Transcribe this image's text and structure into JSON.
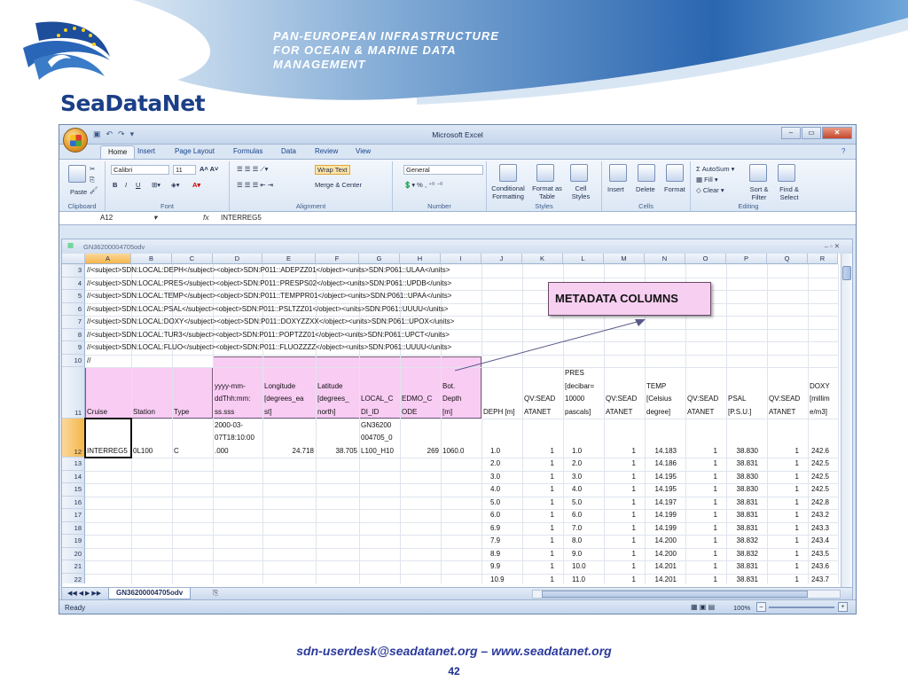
{
  "slide": {
    "header_lines": [
      "PAN-EUROPEAN INFRASTRUCTURE",
      "FOR OCEAN & MARINE DATA",
      "MANAGEMENT"
    ],
    "brand": "SeaDataNet",
    "footer": "sdn-userdesk@seadatanet.org – www.seadatanet.org",
    "page_number": "42",
    "callout": "METADATA COLUMNS",
    "colors": {
      "swoosh_blue": "#2f6fb7",
      "brand_blue": "#1b3f86",
      "callout_pink": "#f7cff1"
    }
  },
  "excel": {
    "window_title": "Microsoft Excel",
    "tabs": [
      "Home",
      "Insert",
      "Page Layout",
      "Formulas",
      "Data",
      "Review",
      "View"
    ],
    "active_tab": "Home",
    "ribbon": {
      "clipboard": {
        "label": "Clipboard",
        "paste": "Paste"
      },
      "font": {
        "label": "Font",
        "family": "Calibri",
        "size": "11",
        "bold": "B",
        "italic": "I",
        "underline": "U"
      },
      "alignment": {
        "label": "Alignment",
        "wrap": "Wrap Text",
        "merge": "Merge & Center"
      },
      "number": {
        "label": "Number",
        "format": "General"
      },
      "styles": {
        "label": "Styles",
        "conditional": "Conditional Formatting",
        "format_table": "Format as Table",
        "cell_styles": "Cell Styles"
      },
      "cells": {
        "label": "Cells",
        "insert": "Insert",
        "delete": "Delete",
        "format": "Format"
      },
      "editing": {
        "label": "Editing",
        "autosum": "AutoSum",
        "fill": "Fill",
        "clear": "Clear",
        "sort": "Sort & Filter",
        "find": "Find & Select"
      }
    },
    "name_box": "A12",
    "formula_value": "INTERREG5",
    "workbook_title": "GN36200004705odv",
    "sheet_tab": "GN36200004705odv",
    "status": "Ready",
    "zoom": "100%",
    "columns": [
      "A",
      "B",
      "C",
      "D",
      "E",
      "F",
      "G",
      "H",
      "I",
      "J",
      "K",
      "L",
      "M",
      "N",
      "O",
      "P",
      "Q",
      "R"
    ],
    "meta_rows": [
      {
        "row": "3",
        "text": "//<subject>SDN:LOCAL:DEPH</subject><object>SDN:P011::ADEPZZ01</object><units>SDN:P061::ULAA</units>"
      },
      {
        "row": "4",
        "text": "//<subject>SDN:LOCAL:PRES</subject><object>SDN:P011::PRESPS02</object><units>SDN:P061::UPDB</units>"
      },
      {
        "row": "5",
        "text": "//<subject>SDN:LOCAL:TEMP</subject><object>SDN:P011::TEMPPR01</object><units>SDN:P061::UPAA</units>"
      },
      {
        "row": "6",
        "text": "//<subject>SDN:LOCAL:PSAL</subject><object>SDN:P011::PSLTZZ01</object><units>SDN:P061::UUUU</units>"
      },
      {
        "row": "7",
        "text": "//<subject>SDN:LOCAL:DOXY</subject><object>SDN:P011::DOXYZZXX</object><units>SDN:P061::UPOX</units>"
      },
      {
        "row": "8",
        "text": "//<subject>SDN:LOCAL:TUR3</subject><object>SDN:P011::POPTZZ01</object><units>SDN:P061::UPCT</units>"
      },
      {
        "row": "9",
        "text": "//<subject>SDN:LOCAL:FLUO</subject><object>SDN:P011::FLUOZZZZ</object><units>SDN:P061::UUUU</units>"
      },
      {
        "row": "10",
        "text": "//"
      }
    ],
    "headers": {
      "A": [
        "Cruise"
      ],
      "B": [
        "Station"
      ],
      "C": [
        "Type"
      ],
      "D": [
        "yyyy-mm-",
        "ddThh:mm:",
        "ss.sss"
      ],
      "E": [
        "Longitude",
        "[degrees_ea",
        "st]"
      ],
      "F": [
        "Latitude",
        "[degrees_",
        "north]"
      ],
      "G": [
        "LOCAL_C",
        "DI_ID"
      ],
      "H": [
        "EDMO_C",
        "ODE"
      ],
      "I": [
        "Bot.",
        "Depth",
        "[m]"
      ],
      "J": [
        "DEPH [m]"
      ],
      "K": [
        "QV:SEAD",
        "ATANET"
      ],
      "L": [
        "PRES",
        "[decibar=",
        "10000",
        "pascals]"
      ],
      "M": [
        "QV:SEAD",
        "ATANET"
      ],
      "N": [
        "TEMP",
        "[Celsius",
        "degree]"
      ],
      "O": [
        "QV:SEAD",
        "ATANET"
      ],
      "P": [
        "PSAL",
        "[P.S.U.]"
      ],
      "Q": [
        "QV:SEAD",
        "ATANET"
      ],
      "R": [
        "DOXY",
        "[millim",
        "e/m3]"
      ]
    },
    "row12": {
      "A": "INTERREG5",
      "B": "0L100",
      "C": "C",
      "D": [
        "2000-03-",
        "07T18:10:00",
        ".000"
      ],
      "E": "24.718",
      "F": "38.705",
      "G": [
        "GN36200",
        "004705_0",
        "L100_H10"
      ],
      "H": "269",
      "I": "1060.0"
    },
    "data_rows": [
      {
        "row": "12",
        "J": "1.0",
        "K": "1",
        "L": "1.0",
        "M": "1",
        "N": "14.183",
        "O": "1",
        "P": "38.830",
        "Q": "1",
        "R": "242.6"
      },
      {
        "row": "13",
        "J": "2.0",
        "K": "1",
        "L": "2.0",
        "M": "1",
        "N": "14.186",
        "O": "1",
        "P": "38.831",
        "Q": "1",
        "R": "242.5"
      },
      {
        "row": "14",
        "J": "3.0",
        "K": "1",
        "L": "3.0",
        "M": "1",
        "N": "14.195",
        "O": "1",
        "P": "38.830",
        "Q": "1",
        "R": "242.5"
      },
      {
        "row": "15",
        "J": "4.0",
        "K": "1",
        "L": "4.0",
        "M": "1",
        "N": "14.195",
        "O": "1",
        "P": "38.830",
        "Q": "1",
        "R": "242.5"
      },
      {
        "row": "16",
        "J": "5.0",
        "K": "1",
        "L": "5.0",
        "M": "1",
        "N": "14.197",
        "O": "1",
        "P": "38.831",
        "Q": "1",
        "R": "242.8"
      },
      {
        "row": "17",
        "J": "6.0",
        "K": "1",
        "L": "6.0",
        "M": "1",
        "N": "14.199",
        "O": "1",
        "P": "38.831",
        "Q": "1",
        "R": "243.2"
      },
      {
        "row": "18",
        "J": "6.9",
        "K": "1",
        "L": "7.0",
        "M": "1",
        "N": "14.199",
        "O": "1",
        "P": "38.831",
        "Q": "1",
        "R": "243.3"
      },
      {
        "row": "19",
        "J": "7.9",
        "K": "1",
        "L": "8.0",
        "M": "1",
        "N": "14.200",
        "O": "1",
        "P": "38.832",
        "Q": "1",
        "R": "243.4"
      },
      {
        "row": "20",
        "J": "8.9",
        "K": "1",
        "L": "9.0",
        "M": "1",
        "N": "14.200",
        "O": "1",
        "P": "38.832",
        "Q": "1",
        "R": "243.5"
      },
      {
        "row": "21",
        "J": "9.9",
        "K": "1",
        "L": "10.0",
        "M": "1",
        "N": "14.201",
        "O": "1",
        "P": "38.831",
        "Q": "1",
        "R": "243.6"
      },
      {
        "row": "22",
        "J": "10.9",
        "K": "1",
        "L": "11.0",
        "M": "1",
        "N": "14.201",
        "O": "1",
        "P": "38.831",
        "Q": "1",
        "R": "243.7"
      }
    ]
  }
}
